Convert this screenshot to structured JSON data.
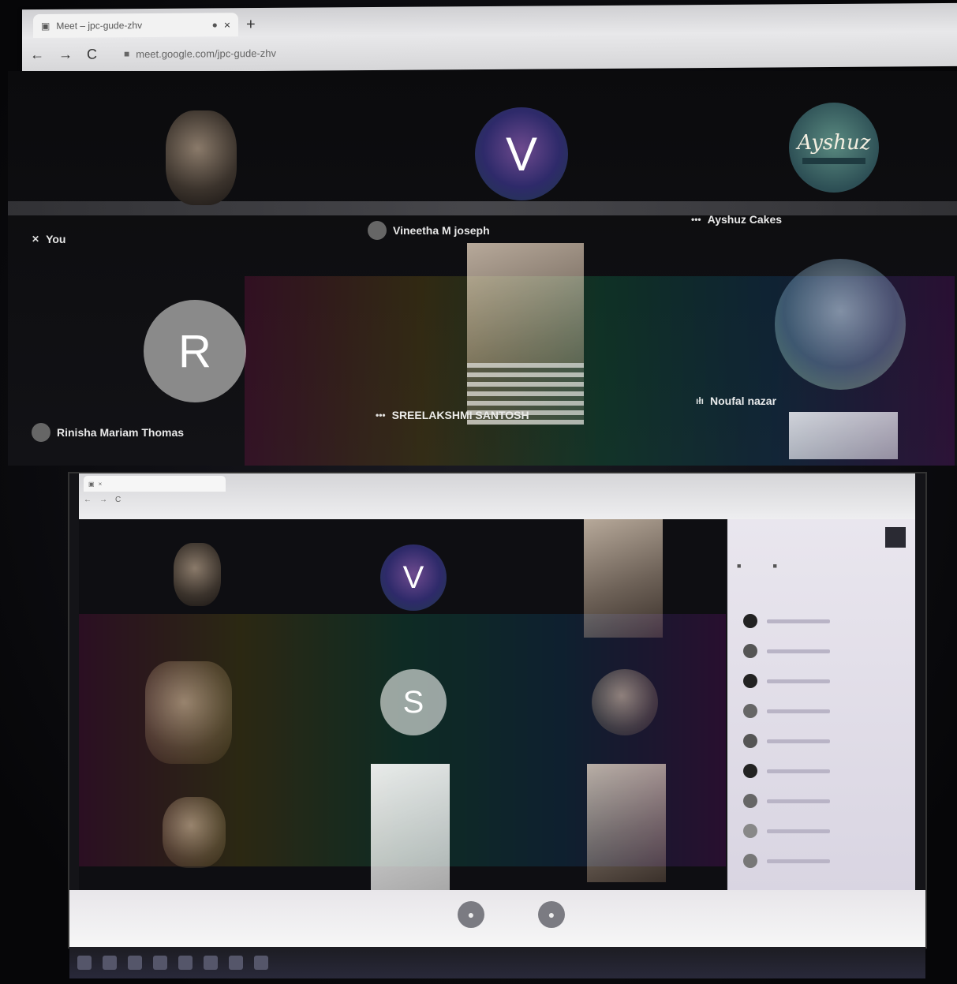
{
  "browser": {
    "tab_title": "Meet – jpc-gude-zhv",
    "tab_close": "×",
    "new_tab": "+",
    "nav_back": "←",
    "nav_forward": "→",
    "nav_reload": "C",
    "url": "meet.google.com/jpc-gude-zhv"
  },
  "participants_top": [
    {
      "name": "You"
    },
    {
      "name": "Vineetha M joseph",
      "initial": "V"
    },
    {
      "name": "Ayshuz Cakes",
      "logo_text": "Ayshuz"
    },
    {
      "name": "Rinisha Mariam Thomas",
      "initial": "R"
    },
    {
      "name": "SREELAKSHMI SANTOSH"
    },
    {
      "name": "Noufal nazar"
    }
  ],
  "laptop": {
    "participants": [
      {
        "initial": "V"
      },
      {
        "initial": "S"
      }
    ]
  },
  "icons": {
    "mic_muted": "✕",
    "more": "•••",
    "speaking": "ıłı",
    "lock": "🔒"
  }
}
